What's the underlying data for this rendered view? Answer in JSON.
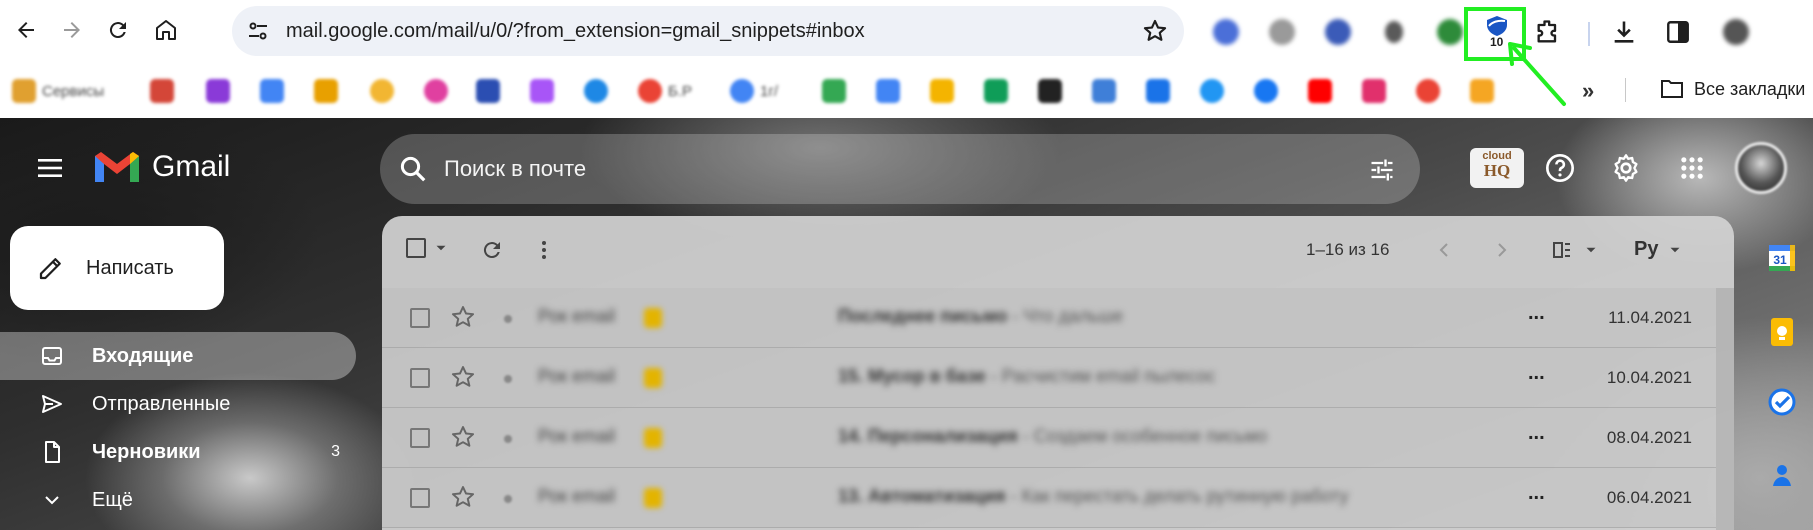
{
  "browser": {
    "url": "mail.google.com/mail/u/0/?from_extension=gmail_snippets#inbox",
    "extension_badge": "10",
    "bookmarks": [
      {
        "label": "Сервисы",
        "color": "#e0a030"
      },
      {
        "label": "",
        "color": "#d44638"
      },
      {
        "label": "",
        "color": "#8a3ad8"
      },
      {
        "label": "",
        "color": "#4285f4"
      },
      {
        "label": "",
        "color": "#e8a000"
      },
      {
        "label": "",
        "color": "#f2b632"
      },
      {
        "label": "",
        "color": "#e040a0"
      },
      {
        "label": "",
        "color": "#2b4eb2"
      },
      {
        "label": "",
        "color": "#a855f7"
      },
      {
        "label": "",
        "color": "#1e88e5"
      },
      {
        "label": "Б.Р",
        "color": "#ea4335"
      },
      {
        "label": "1г/",
        "color": "#4285f4"
      },
      {
        "label": "",
        "color": "#34a853"
      },
      {
        "label": "",
        "color": "#4285f4"
      },
      {
        "label": "",
        "color": "#f4b400"
      },
      {
        "label": "",
        "color": "#0f9d58"
      },
      {
        "label": "",
        "color": "#222222"
      },
      {
        "label": "",
        "color": "#3f7fd8"
      },
      {
        "label": "",
        "color": "#1a73e8"
      },
      {
        "label": "",
        "color": "#2196f3"
      },
      {
        "label": "",
        "color": "#1877f2"
      },
      {
        "label": "",
        "color": "#ff0000"
      },
      {
        "label": "",
        "color": "#e1306c"
      },
      {
        "label": "",
        "color": "#ea4335"
      },
      {
        "label": "",
        "color": "#f5a623"
      }
    ],
    "all_bookmarks_label": "Все закладки"
  },
  "gmail": {
    "logo_text": "Gmail",
    "search_placeholder": "Поиск в почте",
    "cloudhq_line1": "cloud",
    "cloudhq_line2": "HQ",
    "compose_label": "Написать",
    "nav": [
      {
        "label": "Входящие",
        "count": ""
      },
      {
        "label": "Отправленные",
        "count": ""
      },
      {
        "label": "Черновики",
        "count": "3"
      },
      {
        "label": "Ещё",
        "count": ""
      }
    ],
    "pager": "1–16 из 16",
    "language": "Ру",
    "emails": [
      {
        "sender": "Рок email",
        "subject": "Последнее письмо",
        "snippet": " - Что дальше",
        "date": "11.04.2021"
      },
      {
        "sender": "Рок email",
        "subject": "15. Мусор в базе",
        "snippet": " - Расчистим email пылесос",
        "date": "10.04.2021"
      },
      {
        "sender": "Рок email",
        "subject": "14. Персонализация",
        "snippet": " - Создаем особенное письмо",
        "date": "08.04.2021"
      },
      {
        "sender": "Рок email",
        "subject": "13. Автоматизация",
        "snippet": " - Как перестать делать рутинную работу",
        "date": "06.04.2021"
      }
    ],
    "more_dots": "...",
    "calendar_day": "31"
  },
  "colors": {
    "highlight": "#22ee22",
    "gmail_red": "#ea4335",
    "gmail_blue": "#4285f4",
    "gmail_yellow": "#fbbc04",
    "gmail_green": "#34a853"
  }
}
